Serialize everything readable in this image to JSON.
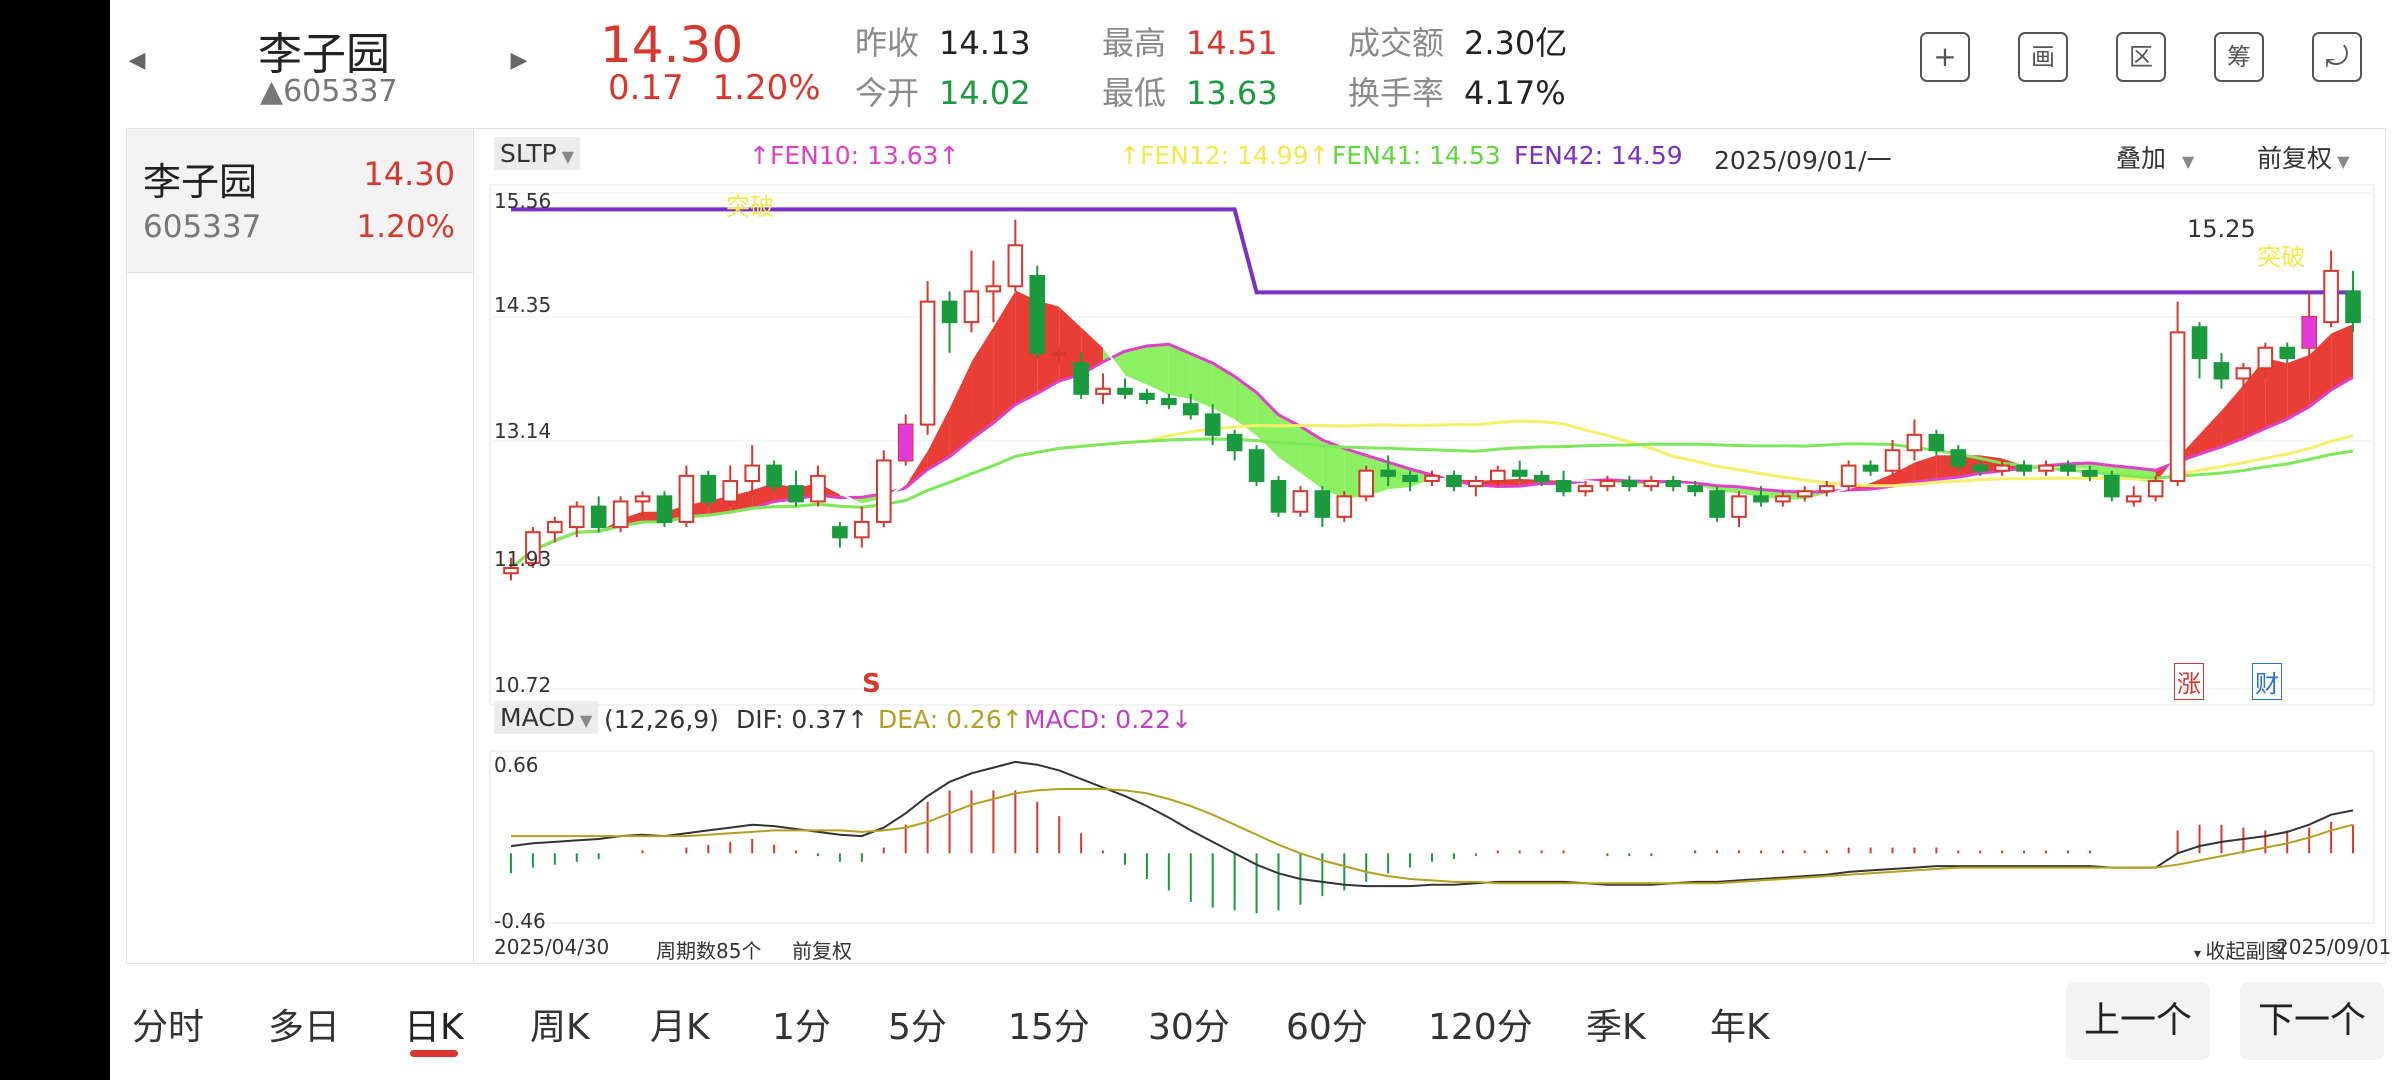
{
  "header": {
    "prev_icon": "chevron-left-icon",
    "next_icon": "chevron-right-icon",
    "stock_name": "李子园",
    "stock_code": "▲605337",
    "price": "14.30",
    "change": "0.17",
    "change_pct": "1.20%",
    "stats": [
      {
        "label": "昨收",
        "value": "14.13"
      },
      {
        "label": "今开",
        "value": "14.02"
      },
      {
        "label": "最高",
        "value": "14.51"
      },
      {
        "label": "最低",
        "value": "13.63"
      },
      {
        "label": "成交额",
        "value": "2.30亿"
      },
      {
        "label": "换手率",
        "value": "4.17%"
      }
    ],
    "tools": [
      {
        "icon": "add-icon",
        "glyph": "+"
      },
      {
        "icon": "draw-icon",
        "glyph": "画"
      },
      {
        "icon": "range-icon",
        "glyph": "区"
      },
      {
        "icon": "chips-icon",
        "glyph": "筹"
      },
      {
        "icon": "rotate-screen-icon",
        "glyph": "⤾"
      }
    ]
  },
  "sidebar": {
    "name": "李子园",
    "price": "14.30",
    "code": "605337",
    "pct": "1.20%"
  },
  "main_chart": {
    "indicator": "SLTP",
    "fen10": "↑FEN10: 13.63↑",
    "fen12": "↑FEN12: 14.99↑",
    "fen41": "FEN41: 14.53",
    "fen42": "FEN42: 14.59",
    "date": "2025/09/01/一",
    "overlay": "叠加",
    "adjust": "前复权",
    "y_labels": [
      "15.56",
      "14.35",
      "13.14",
      "11.93",
      "10.72"
    ],
    "ann_break1": "突破",
    "ann_break2": "突破",
    "ann_high": "15.25",
    "marker_s": "S",
    "marker_limit": "涨",
    "marker_fin": "财"
  },
  "macd": {
    "indicator": "MACD",
    "params": "(12,26,9)",
    "dif": "DIF: 0.37↑",
    "dea": "DEA: 0.26↑",
    "macd": "MACD: 0.22↓",
    "y_top": "0.66",
    "y_bottom": "-0.46"
  },
  "footer": {
    "start_date": "2025/04/30",
    "period_count": "周期数85个",
    "adjust": "前复权",
    "collapse": "收起副图",
    "end_date": "2025/09/01"
  },
  "tabs": [
    "分时",
    "多日",
    "日K",
    "周K",
    "月K",
    "1分",
    "5分",
    "15分",
    "30分",
    "60分",
    "120分",
    "季K",
    "年K"
  ],
  "active_tab": "日K",
  "nav": {
    "prev": "上一个",
    "next": "下一个"
  },
  "colors": {
    "up": "#d7372d",
    "down": "#1b9a3e",
    "fen10": "#e040c8",
    "fen12": "#f5f06a",
    "fen41": "#7ce85a",
    "fen42": "#7a2fc8"
  },
  "chart_data": {
    "type": "candlestick",
    "title": "",
    "ylim": [
      10.72,
      15.56
    ],
    "y_ticks": [
      15.56,
      14.35,
      13.14,
      11.93,
      10.72
    ],
    "x_range": [
      "2025/04/30",
      "2025/09/01"
    ],
    "count": 85,
    "series": [
      {
        "name": "FEN10",
        "last": 13.63
      },
      {
        "name": "FEN12",
        "last": 14.99
      },
      {
        "name": "FEN41",
        "last": 14.53
      },
      {
        "name": "FEN42",
        "last": 14.59
      }
    ],
    "candles": [
      [
        11.85,
        11.9,
        11.78,
        12.0
      ],
      [
        11.95,
        12.25,
        11.9,
        12.3
      ],
      [
        12.25,
        12.35,
        12.15,
        12.4
      ],
      [
        12.3,
        12.5,
        12.2,
        12.55
      ],
      [
        12.5,
        12.3,
        12.25,
        12.6
      ],
      [
        12.3,
        12.55,
        12.25,
        12.6
      ],
      [
        12.55,
        12.6,
        12.4,
        12.65
      ],
      [
        12.6,
        12.35,
        12.3,
        12.65
      ],
      [
        12.35,
        12.8,
        12.3,
        12.9
      ],
      [
        12.8,
        12.55,
        12.5,
        12.85
      ],
      [
        12.55,
        12.75,
        12.5,
        12.9
      ],
      [
        12.75,
        12.9,
        12.6,
        13.1
      ],
      [
        12.9,
        12.7,
        12.65,
        12.95
      ],
      [
        12.7,
        12.55,
        12.5,
        12.85
      ],
      [
        12.55,
        12.8,
        12.5,
        12.9
      ],
      [
        12.3,
        12.2,
        12.1,
        12.35
      ],
      [
        12.2,
        12.35,
        12.1,
        12.5
      ],
      [
        12.35,
        12.95,
        12.3,
        13.05
      ],
      [
        12.95,
        13.3,
        12.9,
        13.4
      ],
      [
        13.3,
        14.5,
        13.2,
        14.7
      ],
      [
        14.5,
        14.3,
        14.0,
        14.6
      ],
      [
        14.3,
        14.6,
        14.2,
        15.0
      ],
      [
        14.6,
        14.65,
        14.3,
        14.9
      ],
      [
        14.65,
        15.05,
        14.6,
        15.3
      ],
      [
        14.75,
        14.0,
        13.95,
        14.85
      ],
      [
        14.0,
        14.0,
        13.9,
        14.05
      ],
      [
        13.9,
        13.6,
        13.55,
        14.0
      ],
      [
        13.6,
        13.65,
        13.5,
        13.8
      ],
      [
        13.65,
        13.6,
        13.55,
        13.75
      ],
      [
        13.6,
        13.55,
        13.5,
        13.65
      ],
      [
        13.55,
        13.5,
        13.45,
        13.6
      ],
      [
        13.5,
        13.4,
        13.35,
        13.6
      ],
      [
        13.4,
        13.2,
        13.1,
        13.5
      ],
      [
        13.2,
        13.05,
        12.95,
        13.25
      ],
      [
        13.05,
        12.75,
        12.7,
        13.1
      ],
      [
        12.75,
        12.45,
        12.4,
        12.8
      ],
      [
        12.45,
        12.65,
        12.4,
        12.7
      ],
      [
        12.65,
        12.4,
        12.3,
        12.7
      ],
      [
        12.4,
        12.6,
        12.35,
        12.65
      ],
      [
        12.6,
        12.85,
        12.55,
        12.9
      ],
      [
        12.85,
        12.8,
        12.7,
        13.0
      ],
      [
        12.8,
        12.75,
        12.65,
        12.85
      ],
      [
        12.75,
        12.8,
        12.7,
        12.85
      ],
      [
        12.8,
        12.7,
        12.65,
        12.85
      ],
      [
        12.7,
        12.75,
        12.6,
        12.8
      ],
      [
        12.75,
        12.85,
        12.7,
        12.9
      ],
      [
        12.85,
        12.8,
        12.75,
        12.95
      ],
      [
        12.8,
        12.75,
        12.7,
        12.85
      ],
      [
        12.75,
        12.65,
        12.6,
        12.85
      ],
      [
        12.65,
        12.7,
        12.6,
        12.75
      ],
      [
        12.7,
        12.75,
        12.65,
        12.8
      ],
      [
        12.75,
        12.7,
        12.65,
        12.8
      ],
      [
        12.7,
        12.75,
        12.65,
        12.8
      ],
      [
        12.75,
        12.7,
        12.65,
        12.8
      ],
      [
        12.7,
        12.65,
        12.6,
        12.75
      ],
      [
        12.65,
        12.4,
        12.35,
        12.7
      ],
      [
        12.4,
        12.6,
        12.3,
        12.65
      ],
      [
        12.6,
        12.55,
        12.5,
        12.7
      ],
      [
        12.55,
        12.6,
        12.5,
        12.65
      ],
      [
        12.6,
        12.65,
        12.55,
        12.7
      ],
      [
        12.65,
        12.7,
        12.6,
        12.75
      ],
      [
        12.7,
        12.9,
        12.65,
        12.95
      ],
      [
        12.9,
        12.85,
        12.8,
        12.95
      ],
      [
        12.85,
        13.05,
        12.8,
        13.15
      ],
      [
        13.05,
        13.2,
        12.95,
        13.35
      ],
      [
        13.2,
        13.05,
        13.0,
        13.25
      ],
      [
        13.05,
        12.9,
        12.85,
        13.1
      ],
      [
        12.9,
        12.85,
        12.8,
        12.95
      ],
      [
        12.85,
        12.9,
        12.8,
        12.95
      ],
      [
        12.9,
        12.85,
        12.8,
        12.95
      ],
      [
        12.85,
        12.9,
        12.8,
        12.95
      ],
      [
        12.9,
        12.85,
        12.8,
        12.95
      ],
      [
        12.85,
        12.8,
        12.75,
        12.9
      ],
      [
        12.8,
        12.6,
        12.55,
        12.85
      ],
      [
        12.55,
        12.6,
        12.5,
        12.7
      ],
      [
        12.6,
        12.75,
        12.55,
        12.8
      ],
      [
        12.75,
        14.2,
        12.7,
        14.5
      ],
      [
        14.25,
        13.95,
        13.75,
        14.3
      ],
      [
        13.9,
        13.75,
        13.65,
        14.0
      ],
      [
        13.75,
        13.85,
        13.65,
        13.9
      ],
      [
        13.85,
        14.05,
        13.75,
        14.1
      ],
      [
        14.05,
        13.95,
        13.9,
        14.1
      ],
      [
        14.05,
        14.35,
        13.95,
        14.6
      ],
      [
        14.3,
        14.8,
        14.25,
        15.0
      ],
      [
        14.6,
        14.3,
        14.2,
        14.8
      ]
    ],
    "macd": {
      "ylim": [
        -0.46,
        0.66
      ],
      "dif": [
        0.05,
        0.07,
        0.08,
        0.09,
        0.1,
        0.12,
        0.13,
        0.12,
        0.14,
        0.16,
        0.18,
        0.2,
        0.19,
        0.17,
        0.15,
        0.13,
        0.12,
        0.18,
        0.28,
        0.4,
        0.5,
        0.56,
        0.6,
        0.64,
        0.62,
        0.58,
        0.52,
        0.46,
        0.4,
        0.33,
        0.25,
        0.16,
        0.08,
        0.0,
        -0.08,
        -0.14,
        -0.18,
        -0.2,
        -0.22,
        -0.23,
        -0.23,
        -0.23,
        -0.22,
        -0.22,
        -0.21,
        -0.2,
        -0.2,
        -0.2,
        -0.2,
        -0.21,
        -0.22,
        -0.22,
        -0.22,
        -0.21,
        -0.2,
        -0.2,
        -0.19,
        -0.18,
        -0.17,
        -0.16,
        -0.15,
        -0.13,
        -0.12,
        -0.11,
        -0.1,
        -0.09,
        -0.09,
        -0.09,
        -0.09,
        -0.09,
        -0.09,
        -0.09,
        -0.09,
        -0.1,
        -0.1,
        -0.1,
        0.0,
        0.05,
        0.08,
        0.1,
        0.12,
        0.15,
        0.2,
        0.27,
        0.3
      ],
      "dea": [
        0.12,
        0.12,
        0.12,
        0.12,
        0.12,
        0.12,
        0.12,
        0.12,
        0.12,
        0.13,
        0.14,
        0.15,
        0.16,
        0.16,
        0.16,
        0.16,
        0.15,
        0.16,
        0.18,
        0.22,
        0.28,
        0.34,
        0.38,
        0.42,
        0.44,
        0.45,
        0.45,
        0.45,
        0.44,
        0.42,
        0.38,
        0.33,
        0.27,
        0.2,
        0.13,
        0.06,
        0.0,
        -0.05,
        -0.09,
        -0.13,
        -0.16,
        -0.18,
        -0.19,
        -0.2,
        -0.2,
        -0.21,
        -0.21,
        -0.21,
        -0.21,
        -0.21,
        -0.21,
        -0.21,
        -0.21,
        -0.21,
        -0.21,
        -0.21,
        -0.2,
        -0.19,
        -0.18,
        -0.17,
        -0.16,
        -0.15,
        -0.14,
        -0.13,
        -0.12,
        -0.11,
        -0.1,
        -0.1,
        -0.1,
        -0.1,
        -0.1,
        -0.1,
        -0.1,
        -0.1,
        -0.1,
        -0.1,
        -0.08,
        -0.05,
        -0.02,
        0.01,
        0.04,
        0.07,
        0.11,
        0.16,
        0.2
      ]
    }
  }
}
